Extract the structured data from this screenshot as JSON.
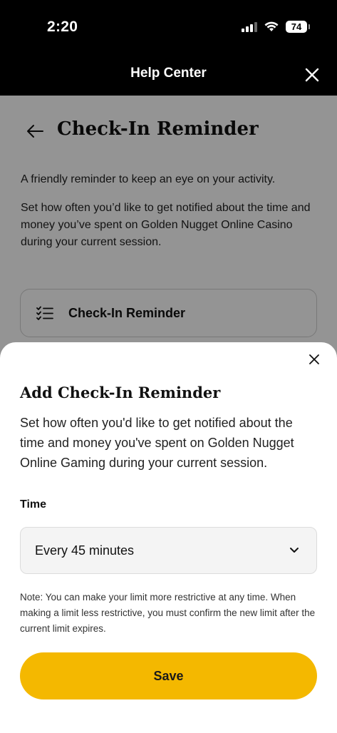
{
  "status_bar": {
    "time": "2:20",
    "battery_level": "74",
    "icons": [
      "cellular-signal-icon",
      "wifi-icon",
      "battery-icon"
    ]
  },
  "header": {
    "title": "Help Center",
    "close_icon": "close-icon"
  },
  "page": {
    "back_icon": "back-arrow-icon",
    "title": "Check-In Reminder",
    "intro": "A friendly reminder to keep an eye on your activity.",
    "description": "Set how often you’d like to get notified about the time and money you’ve spent on Golden Nugget Online Casino during your current session.",
    "card": {
      "icon": "checklist-icon",
      "label": "Check-In Reminder"
    }
  },
  "sheet": {
    "close_icon": "close-icon",
    "title": "Add Check-In Reminder",
    "description": "Set how often you'd like to get notified about the time and money you've spent on Golden Nugget Online Gaming during your current session.",
    "time_label": "Time",
    "time_value": "Every 45 minutes",
    "chevron_icon": "chevron-down-icon",
    "note": "Note: You can make your limit more restrictive at any time. When making a limit less restrictive, you must confirm the new limit after the current limit expires.",
    "save_label": "Save"
  },
  "colors": {
    "accent": "#f4b800",
    "header_bg": "#000000",
    "overlay": "rgba(0,0,0,0.42)"
  }
}
